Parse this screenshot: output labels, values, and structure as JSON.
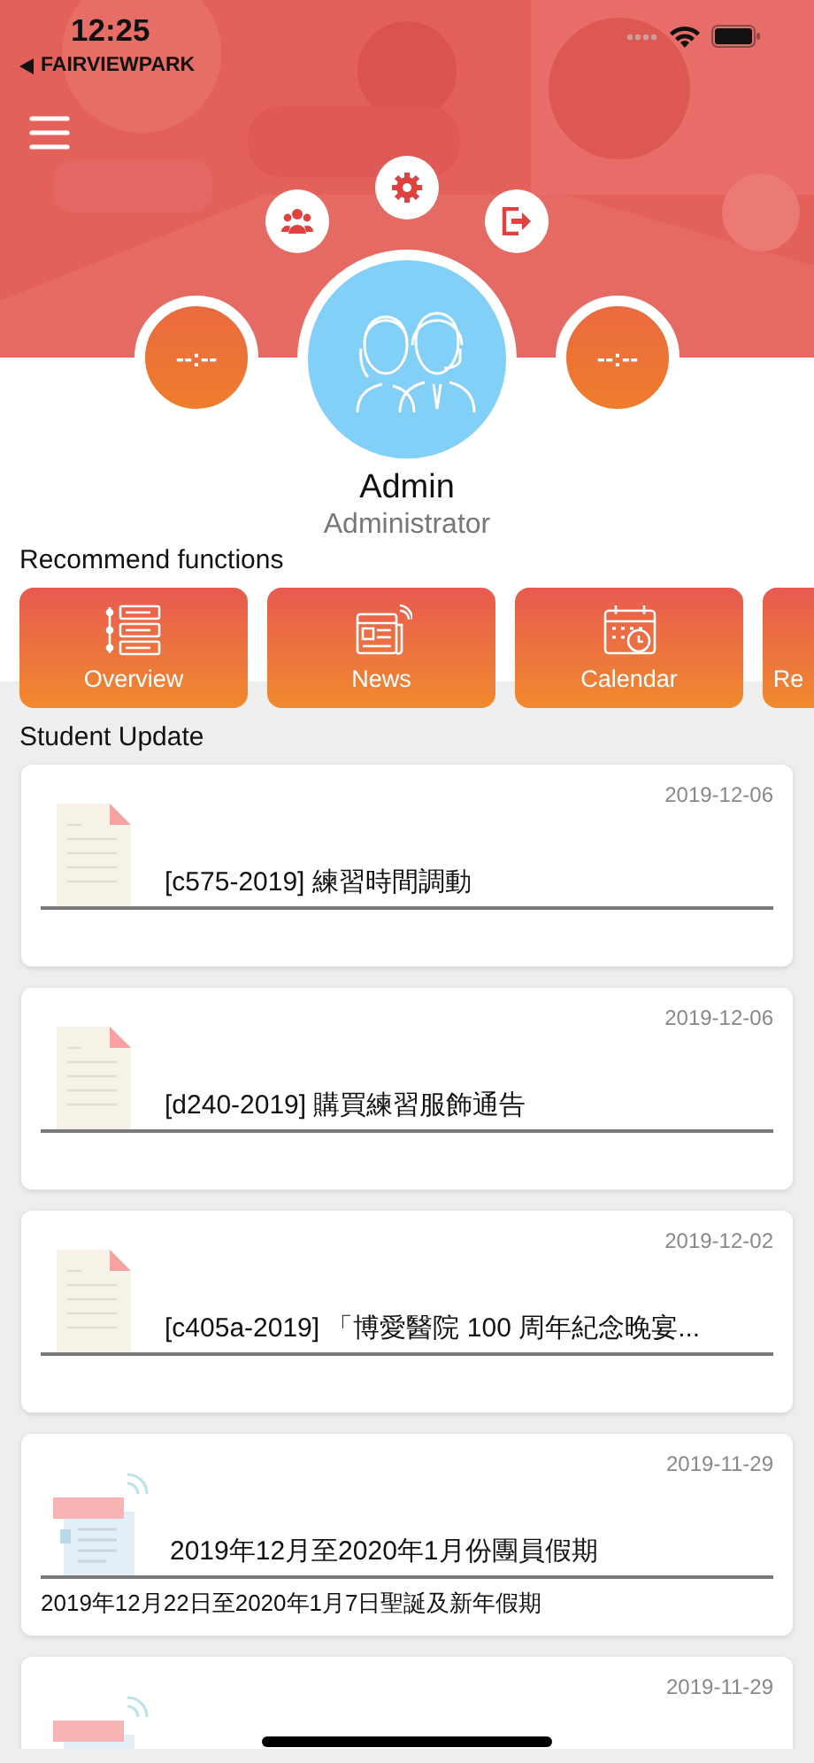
{
  "status_bar": {
    "time": "12:25",
    "back_app": "FAIRVIEWPARK"
  },
  "profile": {
    "name": "Admin",
    "role": "Administrator",
    "clocks": [
      "--:--",
      "--:--"
    ]
  },
  "recommend": {
    "title": "Recommend functions",
    "items": [
      {
        "label": "Overview",
        "kind": "list"
      },
      {
        "label": "News",
        "kind": "news"
      },
      {
        "label": "Calendar",
        "kind": "calendar"
      },
      {
        "label": "Re"
      }
    ]
  },
  "updates": {
    "title": "Student Update",
    "items": [
      {
        "kind": "document",
        "date": "2019-12-06",
        "title": "[c575-2019] 練習時間調動"
      },
      {
        "kind": "document",
        "date": "2019-12-06",
        "title": "[d240-2019] 購買練習服飾通告"
      },
      {
        "kind": "document",
        "date": "2019-12-02",
        "title": "[c405a-2019] 「博愛醫院 100 周年紀念晚宴..."
      },
      {
        "kind": "news",
        "date": "2019-11-29",
        "title": "2019年12月至2020年1月份團員假期",
        "description": "2019年12月22日至2020年1月7日聖誕及新年假期"
      },
      {
        "kind": "news",
        "date": "2019-11-29"
      }
    ]
  }
}
